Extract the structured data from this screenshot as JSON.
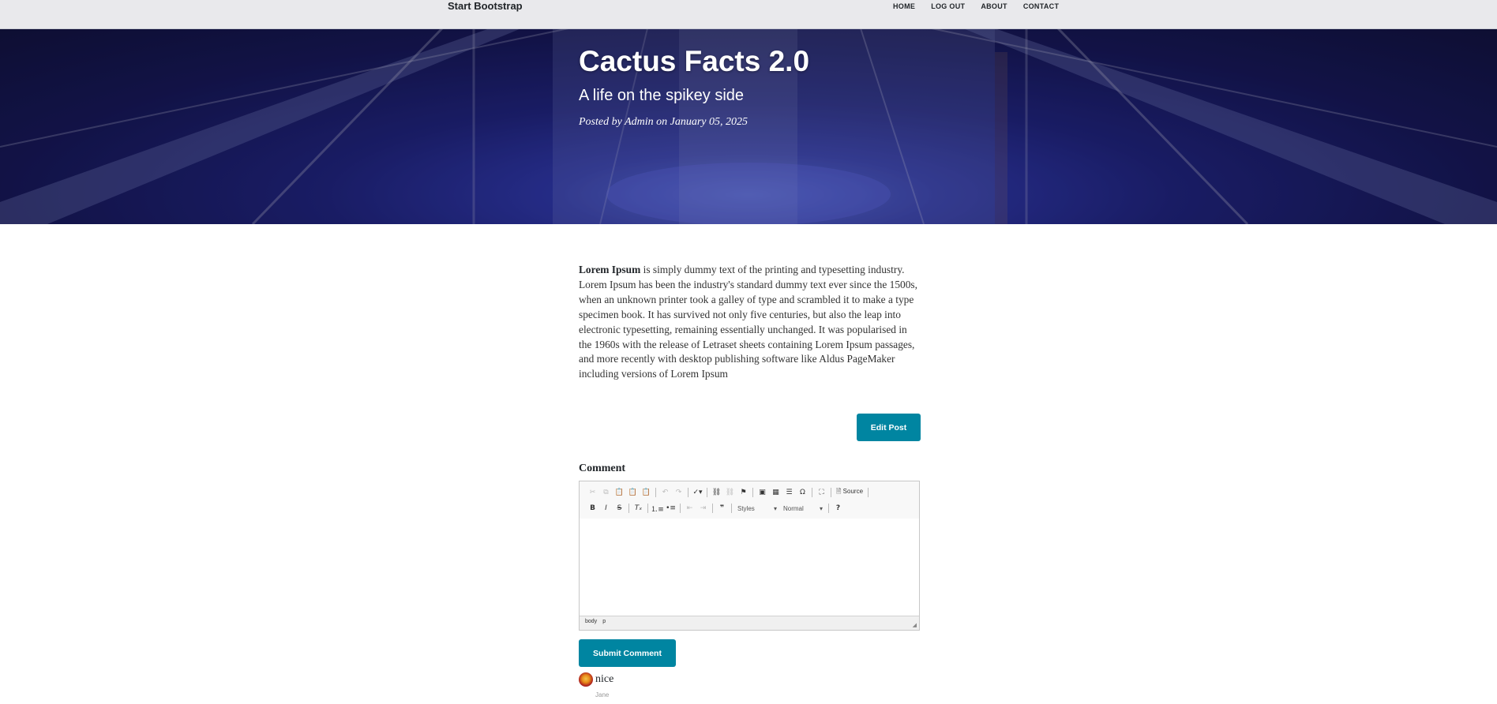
{
  "navbar": {
    "brand": "Start Bootstrap",
    "links": [
      "Home",
      "Log Out",
      "About",
      "Contact"
    ]
  },
  "hero": {
    "title": "Cactus Facts 2.0",
    "subtitle": "A life on the spikey side",
    "meta": "Posted by Admin on January 05, 2025"
  },
  "article": {
    "lead": "Lorem Ipsum",
    "body": " is simply dummy text of the printing and typesetting industry. Lorem Ipsum has been the industry's standard dummy text ever since the 1500s, when an unknown printer took a galley of type and scrambled it to make a type specimen book. It has survived not only five centuries, but also the leap into electronic typesetting, remaining essentially unchanged. It was popularised in the 1960s with the release of Letraset sheets containing Lorem Ipsum passages, and more recently with desktop publishing software like Aldus PageMaker including versions of Lorem Ipsum"
  },
  "edit_button": "Edit Post",
  "comment_form": {
    "label": "Comment",
    "editor": {
      "source_label": "Source",
      "styles_label": "Styles",
      "format_label": "Normal",
      "path": [
        "body",
        "p"
      ]
    },
    "submit_label": "Submit Comment"
  },
  "comments": [
    {
      "text": "nice",
      "author": "Jane"
    }
  ],
  "colors": {
    "accent": "#0085a1",
    "hero_blue": "#2e37a8",
    "navbar_bg": "#e9e9ec"
  }
}
